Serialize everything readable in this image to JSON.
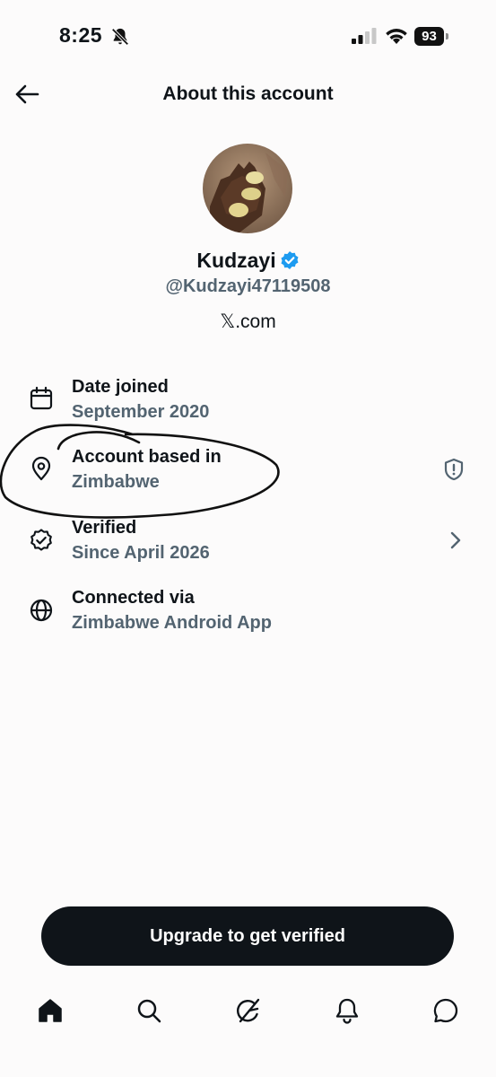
{
  "status_bar": {
    "time": "8:25",
    "battery": "93"
  },
  "header": {
    "title": "About this account"
  },
  "profile": {
    "name": "Kudzayi",
    "handle": "@Kudzayi47119508",
    "site": "𝕏.com"
  },
  "info_rows": [
    {
      "label": "Date joined",
      "value": "September 2020",
      "icon": "calendar-icon"
    },
    {
      "label": "Account based in",
      "value": "Zimbabwe",
      "icon": "location-pin-icon"
    },
    {
      "label": "Verified",
      "value": "Since April 2026",
      "icon": "verified-check-icon"
    },
    {
      "label": "Connected via",
      "value": "Zimbabwe Android App",
      "icon": "globe-icon"
    }
  ],
  "upgrade_button": {
    "label": "Upgrade to get verified"
  },
  "tab_bar": {
    "items": [
      "home-icon",
      "search-icon",
      "grok-icon",
      "notifications-icon",
      "messages-icon"
    ]
  },
  "colors": {
    "text_primary": "#0f1419",
    "text_secondary": "#536471",
    "verified_blue": "#1d9bf0",
    "button_bg": "#0f1419"
  }
}
